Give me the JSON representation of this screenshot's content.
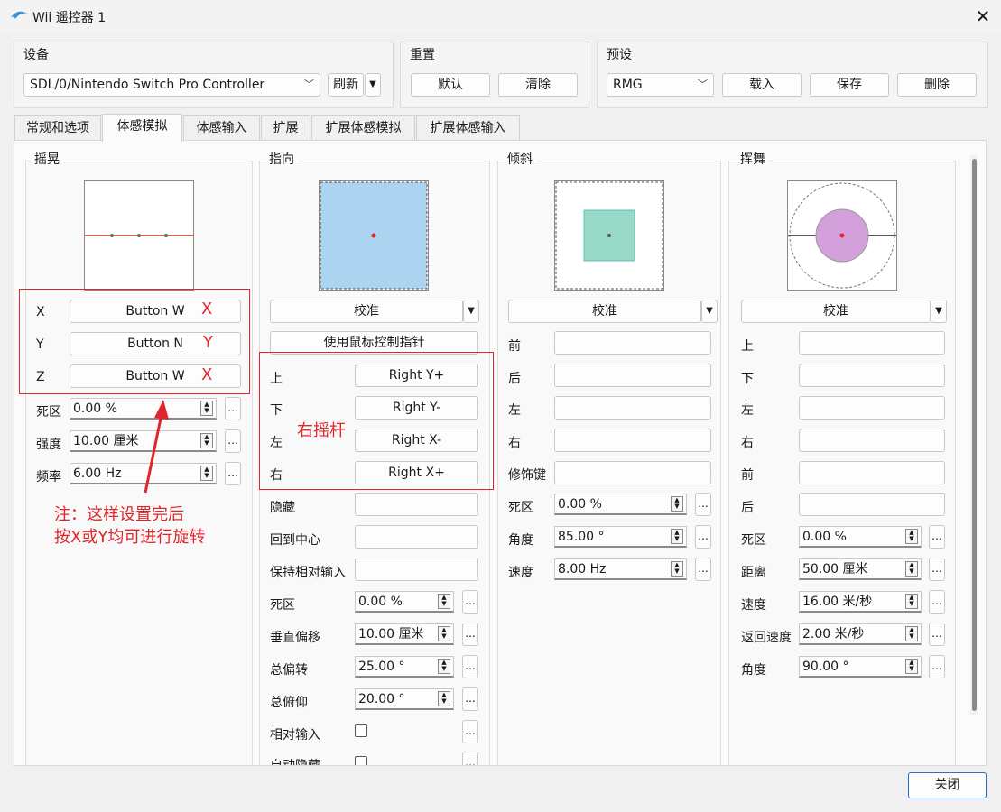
{
  "window": {
    "title": "Wii 遥控器 1"
  },
  "device": {
    "group_label": "设备",
    "selected": "SDL/0/Nintendo Switch Pro Controller",
    "refresh_label": "刷新"
  },
  "reset": {
    "group_label": "重置",
    "default_label": "默认",
    "clear_label": "清除"
  },
  "preset": {
    "group_label": "预设",
    "selected": "RMG",
    "load_label": "载入",
    "save_label": "保存",
    "delete_label": "删除"
  },
  "tabs": [
    {
      "label": "常规和选项"
    },
    {
      "label": "体感模拟"
    },
    {
      "label": "体感输入"
    },
    {
      "label": "扩展"
    },
    {
      "label": "扩展体感模拟"
    },
    {
      "label": "扩展体感输入"
    }
  ],
  "shake": {
    "title": "摇晃",
    "x_label": "X",
    "x_value": "Button W",
    "y_label": "Y",
    "y_value": "Button N",
    "z_label": "Z",
    "z_value": "Button W",
    "deadzone_label": "死区",
    "deadzone_value": "0.00 %",
    "intensity_label": "强度",
    "intensity_value": "10.00 厘米",
    "frequency_label": "频率",
    "frequency_value": "6.00 Hz"
  },
  "point": {
    "title": "指向",
    "calibrate_label": "校准",
    "mouse_label": "使用鼠标控制指针",
    "up_label": "上",
    "up_value": "Right Y+",
    "down_label": "下",
    "down_value": "Right Y-",
    "left_label": "左",
    "left_value": "Right X-",
    "right_label": "右",
    "right_value": "Right X+",
    "hide_label": "隐藏",
    "recenter_label": "回到中心",
    "relative_label": "保持相对输入",
    "deadzone_label": "死区",
    "deadzone_value": "0.00 %",
    "voffset_label": "垂直偏移",
    "voffset_value": "10.00 厘米",
    "yaw_label": "总偏转",
    "yaw_value": "25.00 °",
    "pitch_label": "总俯仰",
    "pitch_value": "20.00 °",
    "relinput_label": "相对输入",
    "autohide_label": "自动隐藏"
  },
  "tilt": {
    "title": "倾斜",
    "calibrate_label": "校准",
    "forward_label": "前",
    "backward_label": "后",
    "left_label": "左",
    "right_label": "右",
    "modifier_label": "修饰键",
    "deadzone_label": "死区",
    "deadzone_value": "0.00 %",
    "angle_label": "角度",
    "angle_value": "85.00 °",
    "speed_label": "速度",
    "speed_value": "8.00 Hz"
  },
  "swing": {
    "title": "挥舞",
    "calibrate_label": "校准",
    "up_label": "上",
    "down_label": "下",
    "left_label": "左",
    "right_label": "右",
    "forward_label": "前",
    "backward_label": "后",
    "deadzone_label": "死区",
    "deadzone_value": "0.00 %",
    "distance_label": "距离",
    "distance_value": "50.00 厘米",
    "speed_label": "速度",
    "speed_value": "16.00 米/秒",
    "return_label": "返回速度",
    "return_value": "2.00 米/秒",
    "angle_label": "角度",
    "angle_value": "90.00 °"
  },
  "annotations": {
    "x_mark": "X",
    "y_mark": "Y",
    "z_mark": "X",
    "stick_note": "右摇杆",
    "note_line1": "注：这样设置完后",
    "note_line2": "按X或Y均可进行旋转"
  },
  "footer": {
    "close_label": "关闭"
  },
  "colors": {
    "annotation_red": "#e0262b",
    "ir_blue": "#acd3ef",
    "tilt_teal": "#98d9c8",
    "swing_purple": "#d3a0dc"
  }
}
